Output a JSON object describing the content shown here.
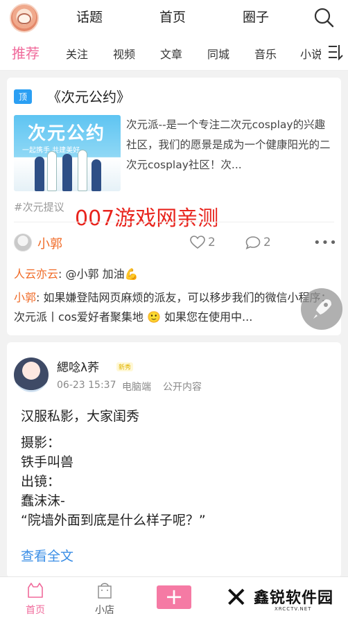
{
  "header": {
    "nav": [
      "话题",
      "首页",
      "圈子"
    ]
  },
  "tabs": [
    "推荐",
    "关注",
    "视频",
    "文章",
    "同城",
    "音乐",
    "小说"
  ],
  "post1": {
    "pin": "顶",
    "title": "《次元公约》",
    "thumb_title": "次元公约",
    "thumb_subtitle": "一起携手  共建美好",
    "excerpt": "次元派--是一个专注二次元cosplay的兴趣社区，我们的愿景是成为一个健康阳光的二次元cosplay社区！次...",
    "hashtag": "#次元提议",
    "watermark": "007游戏网亲测",
    "author": "小郭",
    "likes": "2",
    "comments": "2",
    "more": "•••",
    "comment_list": [
      {
        "who": "人云亦云",
        "text": ": @小郭 加油💪"
      },
      {
        "who": "小郭",
        "text": ": 如果嫌登陆网页麻烦的派友，可以移步我们的微信小程序：次元派丨cos爱好者聚集地 🙂 如果您在使用中..."
      }
    ]
  },
  "post2": {
    "author": "緦唸λ荞",
    "badge": "新秀",
    "date": "06-23 15:37",
    "device": "电脑端",
    "visibility": "公开内容",
    "lines": [
      "汉服私影，大家闺秀",
      "摄影：",
      "铁手叫兽",
      "出镜：",
      "蠢沫沫-",
      "“院墙外面到底是什么样子呢？”"
    ],
    "read_more": "查看全文"
  },
  "bottom_nav": {
    "home": "首页",
    "shop": "小店",
    "plus": "+"
  },
  "brand": {
    "name": "鑫锐软件园",
    "url": "XRCCTV.NET"
  },
  "colors": {
    "accent": "#f06a9b",
    "orange": "#f06a26",
    "link": "#3a8ee6",
    "pin": "#2b9ff3",
    "watermark": "#e8241d"
  }
}
